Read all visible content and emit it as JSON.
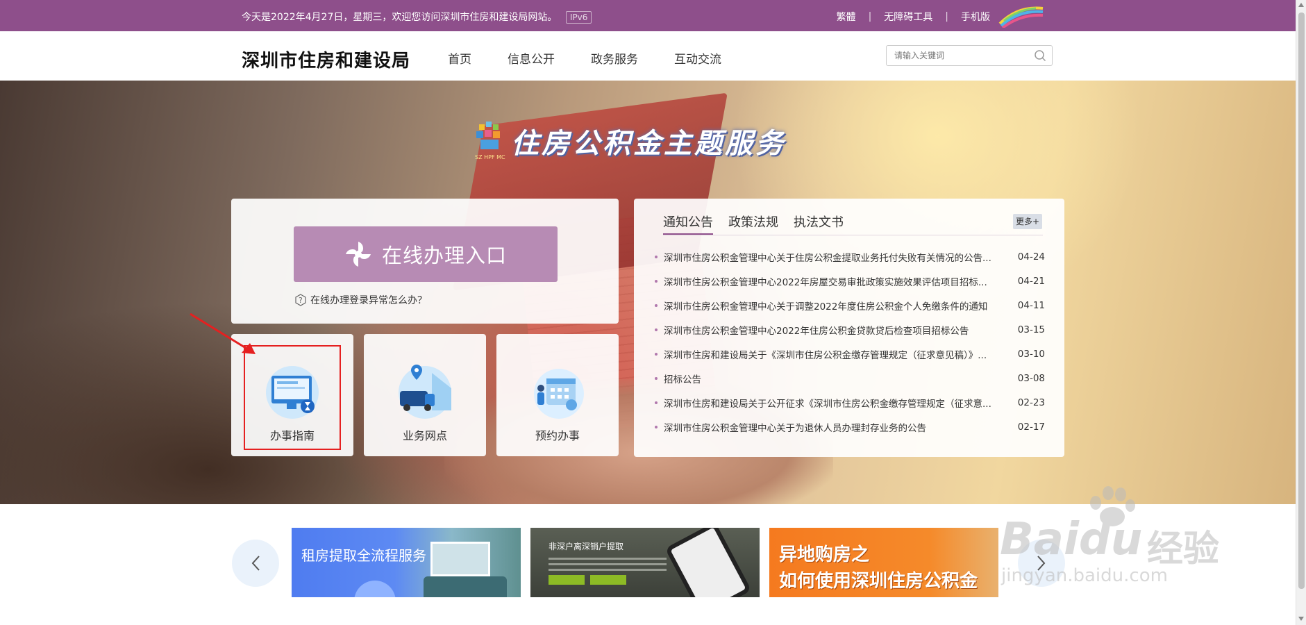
{
  "topbar": {
    "welcome": "今天是2022年4月27日，星期三，欢迎您访问深圳市住房和建设局网站。",
    "ipv6": "IPv6",
    "links": [
      "繁體",
      "无障碍工具",
      "手机版"
    ]
  },
  "header": {
    "site_title": "深圳市住房和建设局",
    "nav": [
      "首页",
      "信息公开",
      "政务服务",
      "互动交流"
    ],
    "search_placeholder": "请输入关键词"
  },
  "banner": {
    "theme_title": "住房公积金主题服务",
    "logo_text": "SZ HPF MC",
    "online_button": "在线办理入口",
    "help_link": "在线办理登录异常怎么办？",
    "cards": [
      "办事指南",
      "业务网点",
      "预约办事"
    ]
  },
  "news": {
    "tabs": [
      "通知公告",
      "政策法规",
      "执法文书"
    ],
    "more": "更多+",
    "items": [
      {
        "title": "深圳市住房公积金管理中心关于住房公积金提取业务托付失败有关情况的公告...",
        "date": "04-24"
      },
      {
        "title": "深圳市住房公积金管理中心2022年房屋交易审批政策实施效果评估项目招标...",
        "date": "04-21"
      },
      {
        "title": "深圳市住房公积金管理中心关于调整2022年度住房公积金个人免缴条件的通知",
        "date": "04-11"
      },
      {
        "title": "深圳市住房公积金管理中心2022年住房公积金贷款贷后检查项目招标公告",
        "date": "03-15"
      },
      {
        "title": "深圳市住房和建设局关于《深圳市住房公积金缴存管理规定（征求意见稿）》...",
        "date": "03-10"
      },
      {
        "title": "招标公告",
        "date": "03-08"
      },
      {
        "title": "深圳市住房和建设局关于公开征求《深圳市住房公积金缴存管理规定（征求意...",
        "date": "02-23"
      },
      {
        "title": "深圳市住房公积金管理中心关于为退休人员办理封存业务的公告",
        "date": "02-17"
      }
    ]
  },
  "carousel": {
    "slide1": "租房提取全流程服务",
    "slide2": "非深户离深销户提取",
    "slide3_line1": "异地购房之",
    "slide3_line2": "如何使用深圳住房公积金"
  },
  "watermark": {
    "brand": "Bai",
    "brand2": "du",
    "cn": "经验",
    "url": "jingyan.baidu.com"
  },
  "colors": {
    "brand_purple": "#8e4f8b",
    "button_purple": "#b78bb4",
    "highlight_red": "#e52020"
  }
}
